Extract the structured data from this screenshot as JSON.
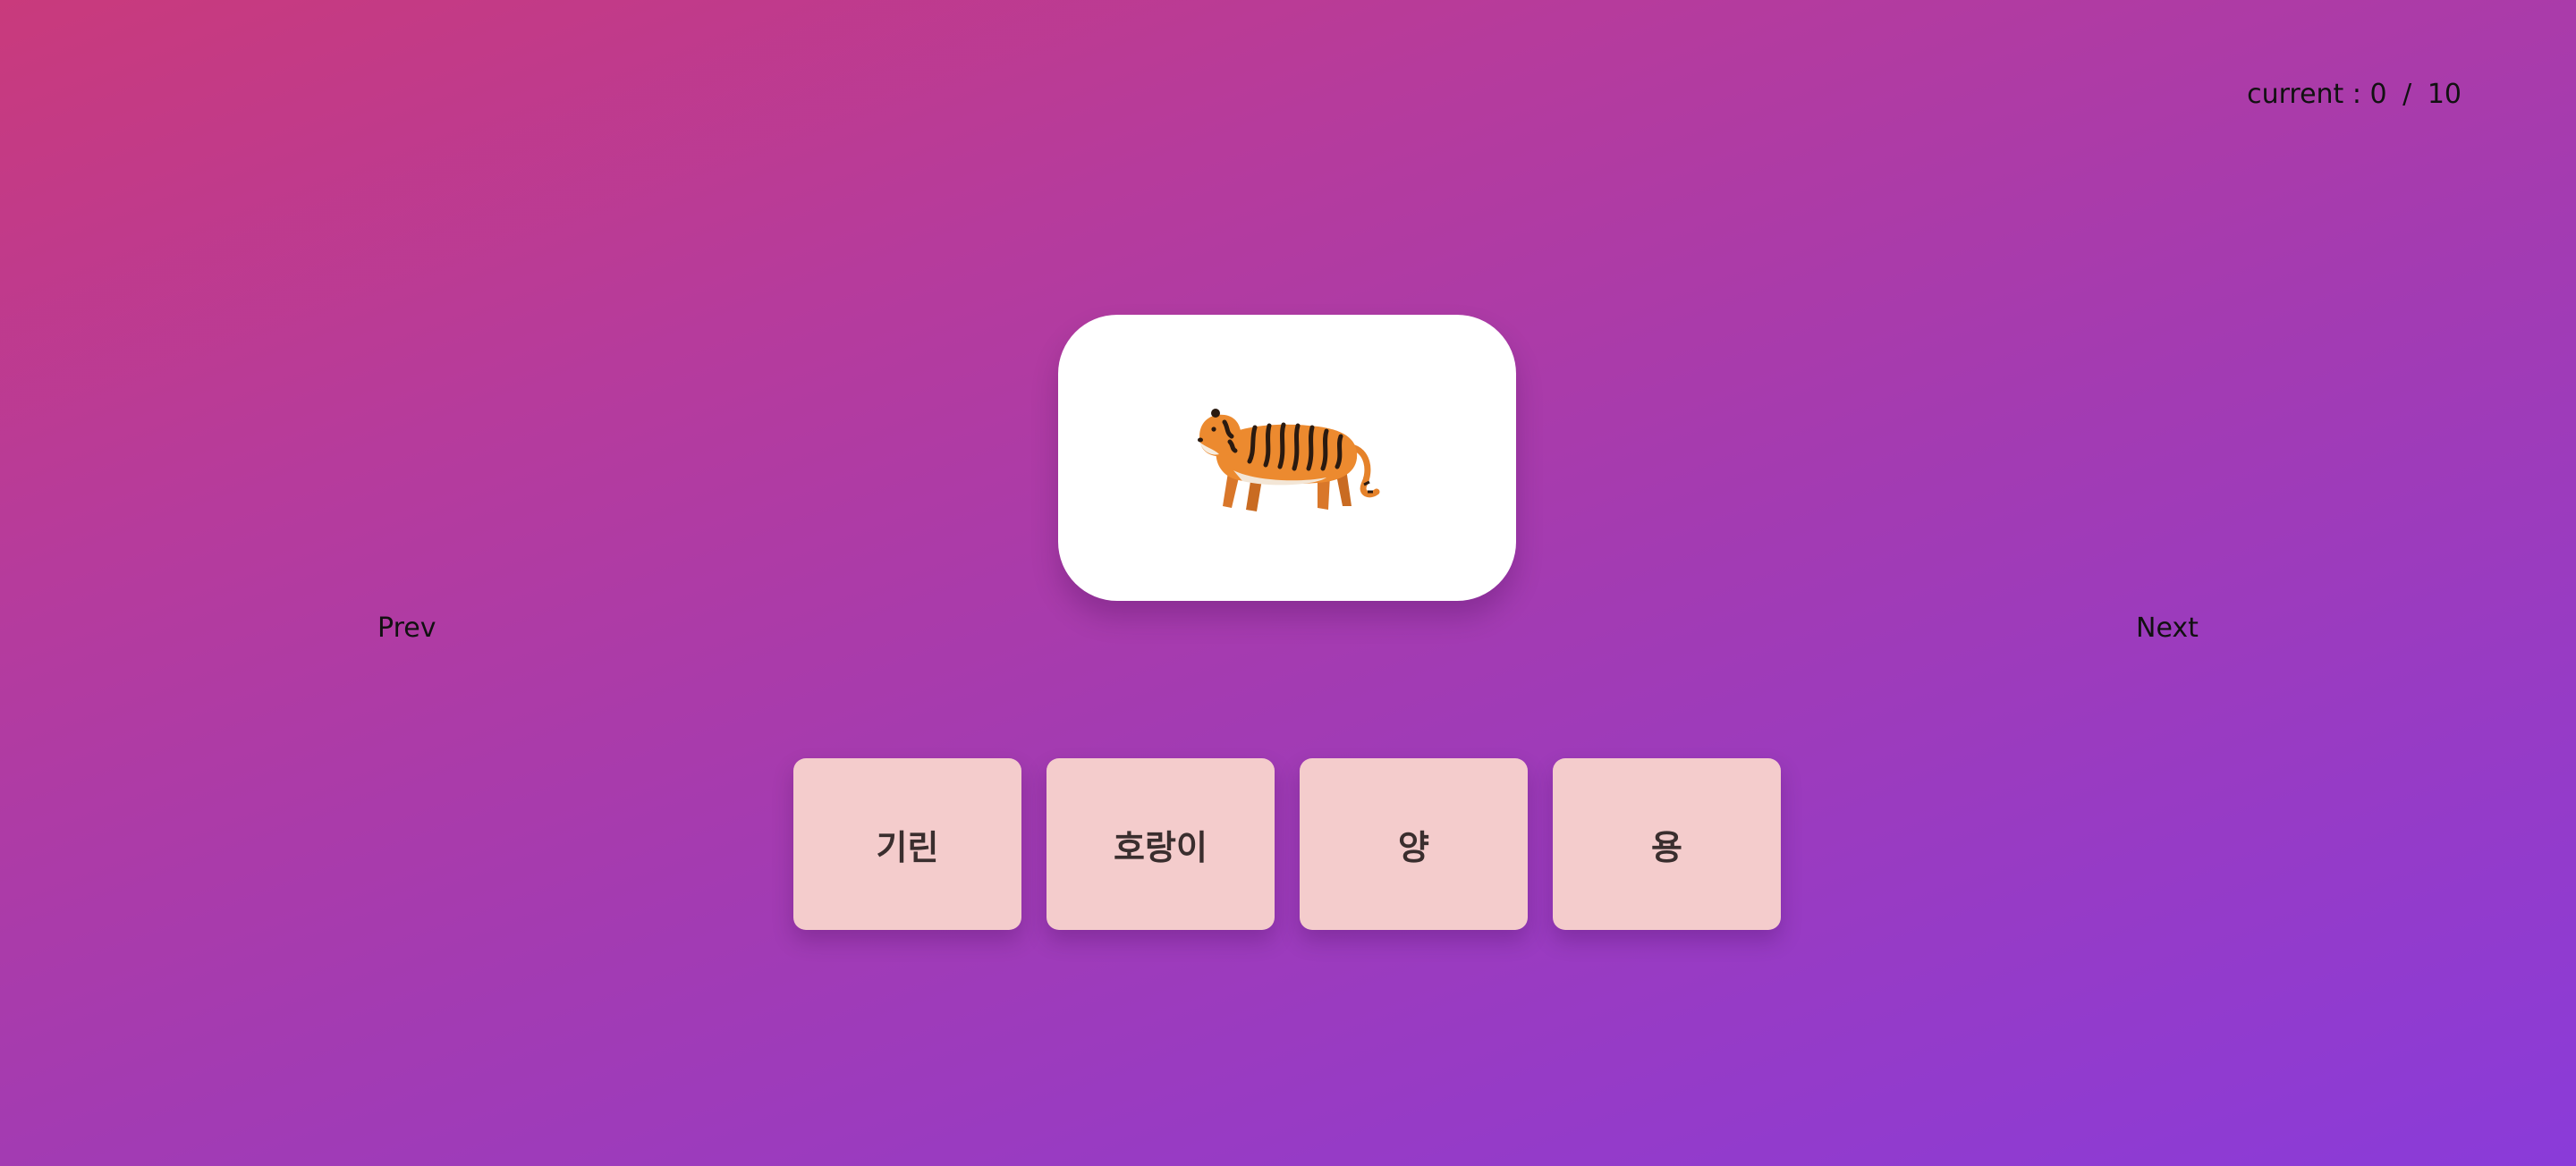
{
  "progress": {
    "label": "current :",
    "current": "0",
    "separator": "/",
    "total": "10"
  },
  "card": {
    "icon": "tiger-icon"
  },
  "nav": {
    "prev_label": "Prev",
    "next_label": "Next"
  },
  "options": [
    {
      "label": "기린"
    },
    {
      "label": "호랑이"
    },
    {
      "label": "양"
    },
    {
      "label": "용"
    }
  ],
  "colors": {
    "background_start": "#c93a7c",
    "background_end": "#8a3bd9",
    "card": "#ffffff",
    "option": "#f4cccc",
    "option_text": "#3a2e2e"
  }
}
